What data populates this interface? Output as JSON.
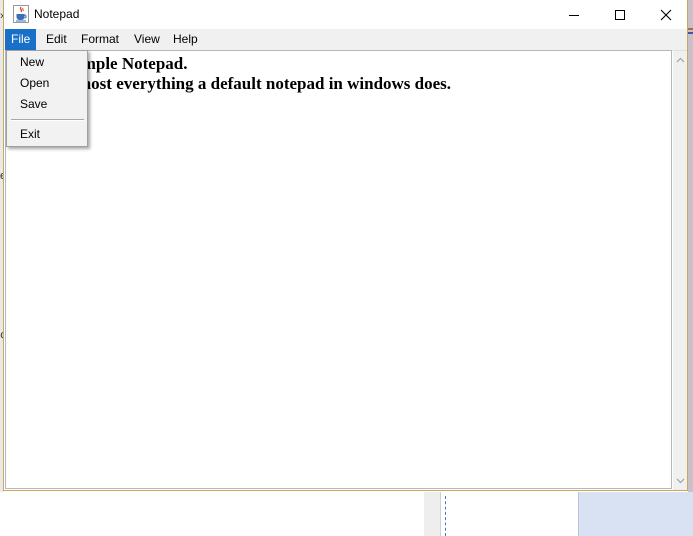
{
  "window": {
    "title": "Notepad",
    "icon": "java-coffee-cup-icon",
    "controls": [
      "minimize-icon",
      "maximize-icon",
      "close-icon"
    ]
  },
  "menubar": {
    "items": [
      {
        "label": "File",
        "active": true
      },
      {
        "label": "Edit",
        "active": false
      },
      {
        "label": "Format",
        "active": false
      },
      {
        "label": "View",
        "active": false
      },
      {
        "label": "Help",
        "active": false
      }
    ]
  },
  "file_menu": {
    "items": [
      "New",
      "Open",
      "Save",
      "Exit"
    ]
  },
  "editor": {
    "lines": [
      "                imple Notepad.",
      "                most everything a default notepad in windows does."
    ]
  },
  "colors": {
    "menu_highlight": "#1a6fc9",
    "window_border": "#c8a95a"
  }
}
